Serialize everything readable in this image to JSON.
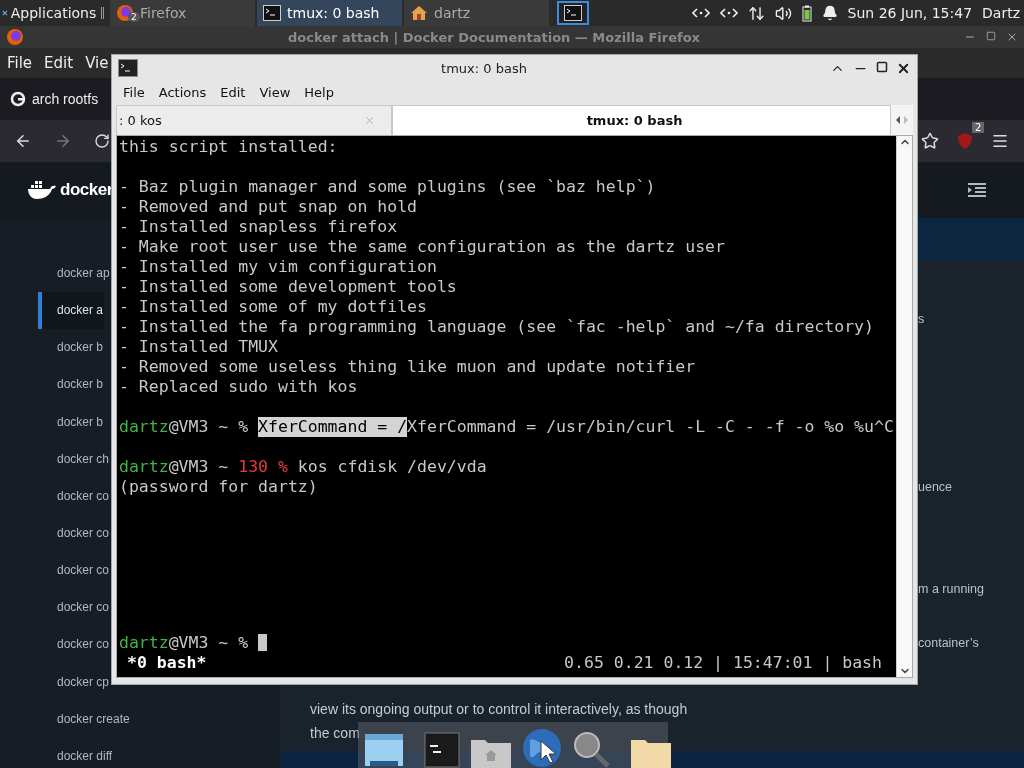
{
  "panel": {
    "apps_label": "Applications",
    "tasks": [
      {
        "label": "Firefox",
        "kind": "firefox",
        "badge": "2",
        "selected": false
      },
      {
        "label": "tmux: 0 bash",
        "kind": "terminal",
        "selected": true
      },
      {
        "label": "dartz",
        "kind": "home",
        "selected": false
      }
    ],
    "clock": "Sun 26 Jun, 15:47",
    "user": "Dartz"
  },
  "browser": {
    "title": "docker attach | Docker Documentation — Mozilla Firefox",
    "menu": [
      "File",
      "Edit",
      "Vie"
    ],
    "tab_title": "arch rootfs",
    "extension_badge": "2",
    "logo_text": "docker",
    "sidebar": [
      {
        "label": "docker ap",
        "selected": false
      },
      {
        "label": "docker a",
        "selected": true
      },
      {
        "label": "docker b",
        "selected": false
      },
      {
        "label": "docker b",
        "selected": false
      },
      {
        "label": "docker b",
        "selected": false
      },
      {
        "label": "docker ch",
        "selected": false
      },
      {
        "label": "docker co",
        "selected": false
      },
      {
        "label": "docker co",
        "selected": false
      },
      {
        "label": "docker co",
        "selected": false
      },
      {
        "label": "docker co",
        "selected": false
      },
      {
        "label": "docker co",
        "selected": false
      },
      {
        "label": "docker cp",
        "selected": false
      },
      {
        "label": "docker create",
        "selected": false
      },
      {
        "label": "docker diff",
        "selected": false
      }
    ],
    "content_fragments": [
      "s",
      "uence",
      "m a running",
      "container’s"
    ],
    "paragraph": [
      "view its ongoing output or to control it interactively, as though",
      "the com"
    ]
  },
  "terminal": {
    "title": "tmux: 0 bash",
    "menu": [
      "File",
      "Actions",
      "Edit",
      "View",
      "Help"
    ],
    "tabs": [
      {
        "label": ": 0 kos",
        "selected": false
      },
      {
        "label": "tmux: 0 bash",
        "selected": true
      }
    ],
    "lines": [
      {
        "kind": "text",
        "segments": [
          {
            "kind": "text",
            "text": "this script installed:"
          }
        ]
      },
      {
        "kind": "blank"
      },
      {
        "kind": "text",
        "segments": [
          {
            "kind": "text",
            "text": "- Baz plugin manager and some plugins (see `baz help`)"
          }
        ]
      },
      {
        "kind": "text",
        "segments": [
          {
            "kind": "text",
            "text": "- Removed and put snap on hold"
          }
        ]
      },
      {
        "kind": "text",
        "segments": [
          {
            "kind": "text",
            "text": "- Installed snapless firefox"
          }
        ]
      },
      {
        "kind": "text",
        "segments": [
          {
            "kind": "text",
            "text": "- Make root user use the same configuration as the dartz user"
          }
        ]
      },
      {
        "kind": "text",
        "segments": [
          {
            "kind": "text",
            "text": "- Installed my vim configuration"
          }
        ]
      },
      {
        "kind": "text",
        "segments": [
          {
            "kind": "text",
            "text": "- Installed some development tools"
          }
        ]
      },
      {
        "kind": "text",
        "segments": [
          {
            "kind": "text",
            "text": "- Installed some of my dotfiles"
          }
        ]
      },
      {
        "kind": "text",
        "segments": [
          {
            "kind": "text",
            "text": "- Installed the fa programming language (see `fac -help` and ~/fa directory)"
          }
        ]
      },
      {
        "kind": "text",
        "segments": [
          {
            "kind": "text",
            "text": "- Installed TMUX"
          }
        ]
      },
      {
        "kind": "text",
        "segments": [
          {
            "kind": "text",
            "text": "- Removed some useless thing like muon and update notifier"
          }
        ]
      },
      {
        "kind": "text",
        "segments": [
          {
            "kind": "text",
            "text": "- Replaced sudo with kos"
          }
        ]
      },
      {
        "kind": "blank"
      },
      {
        "kind": "text",
        "segments": [
          {
            "kind": "user",
            "text": "dartz"
          },
          {
            "kind": "text",
            "text": "@VM3 ~ % "
          },
          {
            "kind": "selected",
            "text": "XferCommand = /"
          },
          {
            "kind": "text",
            "text": "XferCommand = /usr/bin/curl -L -C - -f -o %o %u^C"
          }
        ]
      },
      {
        "kind": "blank"
      },
      {
        "kind": "text",
        "segments": [
          {
            "kind": "user",
            "text": "dartz"
          },
          {
            "kind": "text",
            "text": "@VM3 ~ "
          },
          {
            "kind": "exit",
            "text": "130 %"
          },
          {
            "kind": "text",
            "text": " kos cfdisk /dev/vda"
          }
        ]
      },
      {
        "kind": "text",
        "segments": [
          {
            "kind": "text",
            "text": "(password for dartz)"
          }
        ]
      }
    ],
    "bottom_prompt": {
      "segments": [
        {
          "kind": "user",
          "text": "dartz"
        },
        {
          "kind": "text",
          "text": "@VM3 ~ % "
        }
      ],
      "cursor": true
    },
    "status_left": "*0 bash*",
    "status_right": "0.65 0.21 0.12 | 15:47:01 | bash"
  }
}
